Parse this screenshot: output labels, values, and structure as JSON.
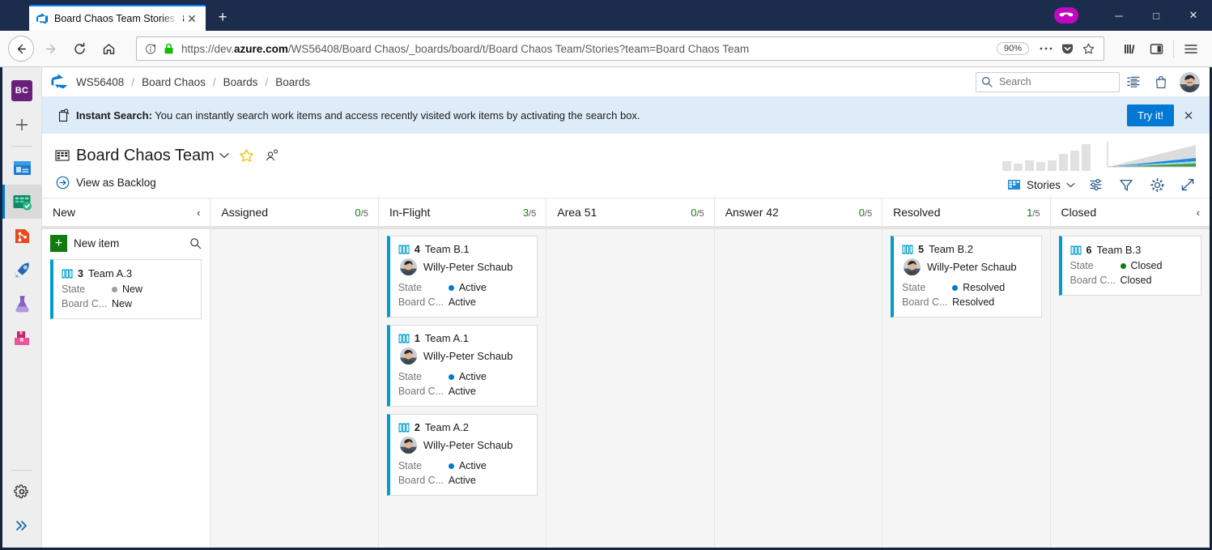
{
  "browser": {
    "tab_title": "Board Chaos Team Stories Board",
    "tab_close_label": "✕",
    "new_tab_label": "+",
    "window_minimize": "─",
    "window_maximize": "□",
    "window_close": "✕",
    "url_prefix": "https://dev.",
    "url_domain": "azure.com",
    "url_suffix": "/WS56408/Board Chaos/_boards/board/t/Board Chaos Team/Stories?team=Board Chaos Team",
    "zoom_level": "90%",
    "icons": {
      "back": "back-arrow-icon",
      "forward": "forward-arrow-icon",
      "reload": "reload-icon",
      "home": "home-icon",
      "page_info": "page-info-icon",
      "lock": "padlock-icon",
      "page_actions": "ellipsis-icon",
      "pocket": "pocket-icon",
      "bookmark": "star-outline-icon",
      "library": "library-icon",
      "sidebar": "sidebar-icon",
      "menu": "hamburger-menu-icon",
      "mask": "private-mask-icon"
    }
  },
  "sidebar": {
    "project_initials": "BC",
    "items": [
      {
        "name": "project-avatar",
        "label": "BC"
      },
      {
        "name": "new-item",
        "label": "+"
      },
      {
        "name": "overview",
        "label": "Overview"
      },
      {
        "name": "boards",
        "label": "Boards"
      },
      {
        "name": "repos",
        "label": "Repos"
      },
      {
        "name": "pipelines",
        "label": "Pipelines"
      },
      {
        "name": "test-plans",
        "label": "Test Plans"
      },
      {
        "name": "artifacts",
        "label": "Artifacts"
      },
      {
        "name": "project-settings",
        "label": "Project settings"
      },
      {
        "name": "expand",
        "label": "Expand"
      }
    ]
  },
  "header": {
    "logo": "azure-devops-logo",
    "breadcrumb": [
      "WS56408",
      "Board Chaos",
      "Boards",
      "Boards"
    ],
    "breadcrumb_separator": "/",
    "search_placeholder": "Search",
    "search_value": "",
    "icons": {
      "search": "search-icon",
      "work": "work-items-icon",
      "marketplace": "shopping-bag-icon",
      "profile": "user-avatar"
    }
  },
  "banner": {
    "icon": "instant-search-icon",
    "title": "Instant Search:",
    "message": " You can instantly search work items and access recently visited work items by activating the search box.",
    "action_label": "Try it!",
    "close_label": "✕"
  },
  "hub": {
    "team_icon": "board-icon",
    "title": "Board Chaos Team",
    "chevron": "⌄",
    "favorite_icon": "star-icon",
    "team_icon_right": "team-members-icon",
    "view_as_backlog": "View as Backlog",
    "backlog_icon": "arrow-right-circle-icon",
    "level_icon": "board-level-icon",
    "level_label": "Stories",
    "level_chevron": "⌄",
    "tools": [
      {
        "name": "board-settings-sliders",
        "label": "Configure board"
      },
      {
        "name": "filter-funnel",
        "label": "Filter"
      },
      {
        "name": "gear",
        "label": "Settings"
      },
      {
        "name": "fullscreen-expand",
        "label": "Enter full screen"
      }
    ]
  },
  "board": {
    "columns": [
      {
        "name": "New",
        "count": null,
        "limit": null,
        "collapsible": true,
        "has_new_item": true,
        "new_item_label": "New item",
        "search_icon": "search-icon",
        "cards": [
          {
            "id": "3",
            "title": "Team A.3",
            "type_icon": "user-story-icon",
            "assignee": null,
            "fields": [
              {
                "label": "State",
                "value": "New",
                "dot": "#9e9e9e"
              },
              {
                "label": "Board C...",
                "value": "New",
                "dot": null
              }
            ]
          }
        ]
      },
      {
        "name": "Assigned",
        "count": "0",
        "limit": "5",
        "collapsible": false,
        "has_new_item": false,
        "cards": []
      },
      {
        "name": "In-Flight",
        "count": "3",
        "limit": "5",
        "collapsible": false,
        "has_new_item": false,
        "cards": [
          {
            "id": "4",
            "title": "Team B.1",
            "type_icon": "user-story-icon",
            "assignee": "Willy-Peter Schaub",
            "fields": [
              {
                "label": "State",
                "value": "Active",
                "dot": "#007acc"
              },
              {
                "label": "Board C...",
                "value": "Active",
                "dot": null
              }
            ]
          },
          {
            "id": "1",
            "title": "Team A.1",
            "type_icon": "user-story-icon",
            "assignee": "Willy-Peter Schaub",
            "fields": [
              {
                "label": "State",
                "value": "Active",
                "dot": "#007acc"
              },
              {
                "label": "Board C...",
                "value": "Active",
                "dot": null
              }
            ]
          },
          {
            "id": "2",
            "title": "Team A.2",
            "type_icon": "user-story-icon",
            "assignee": "Willy-Peter Schaub",
            "fields": [
              {
                "label": "State",
                "value": "Active",
                "dot": "#007acc"
              },
              {
                "label": "Board C...",
                "value": "Active",
                "dot": null
              }
            ]
          }
        ]
      },
      {
        "name": "Area 51",
        "count": "0",
        "limit": "5",
        "collapsible": false,
        "has_new_item": false,
        "cards": []
      },
      {
        "name": "Answer 42",
        "count": "0",
        "limit": "5",
        "collapsible": false,
        "has_new_item": false,
        "cards": []
      },
      {
        "name": "Resolved",
        "count": "1",
        "limit": "5",
        "collapsible": false,
        "has_new_item": false,
        "cards": [
          {
            "id": "5",
            "title": "Team B.2",
            "type_icon": "user-story-icon",
            "assignee": "Willy-Peter Schaub",
            "fields": [
              {
                "label": "State",
                "value": "Resolved",
                "dot": "#007acc"
              },
              {
                "label": "Board C...",
                "value": "Resolved",
                "dot": null
              }
            ]
          }
        ]
      },
      {
        "name": "Closed",
        "count": null,
        "limit": null,
        "collapsible": true,
        "has_new_item": false,
        "cards": [
          {
            "id": "6",
            "title": "Team B.3",
            "type_icon": "user-story-icon",
            "assignee": null,
            "fields": [
              {
                "label": "State",
                "value": "Closed",
                "dot": "#107c10"
              },
              {
                "label": "Board C...",
                "value": "Closed",
                "dot": null
              }
            ]
          }
        ]
      }
    ],
    "collapse_chevron": "‹",
    "count_separator": "/"
  },
  "colors": {
    "accent": "#0078d4",
    "banner_bg": "#deecf9",
    "card_stripe": "#009ccc",
    "green": "#107c10",
    "titlebar": "#1c2c4c"
  }
}
